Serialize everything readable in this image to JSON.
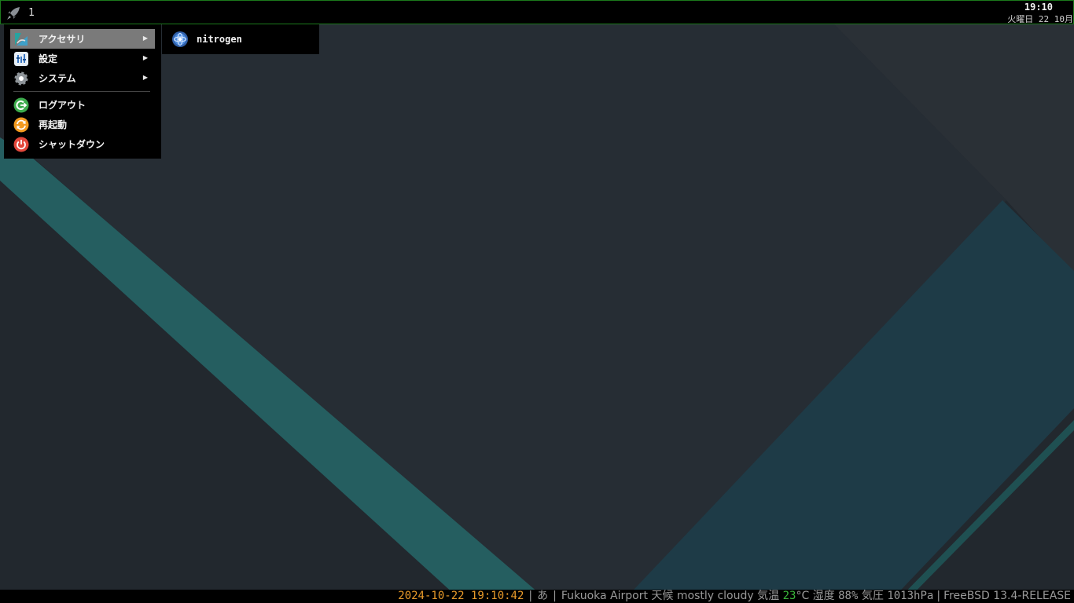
{
  "topbar": {
    "workspace": "1",
    "time": "19:10",
    "date": "火曜日 22 10月"
  },
  "menu": {
    "items": [
      {
        "label": "アクセサリ",
        "icon": "accessories-icon",
        "has_submenu": true,
        "active": true
      },
      {
        "label": "設定",
        "icon": "settings-icon",
        "has_submenu": true
      },
      {
        "label": "システム",
        "icon": "system-gear-icon",
        "has_submenu": true
      },
      {
        "label": "ログアウト",
        "icon": "logout-icon"
      },
      {
        "label": "再起動",
        "icon": "restart-icon"
      },
      {
        "label": "シャットダウン",
        "icon": "shutdown-icon"
      }
    ],
    "arrow": "▶"
  },
  "submenu": {
    "items": [
      {
        "label": "nitrogen",
        "icon": "nitrogen-icon"
      }
    ]
  },
  "statusbar": {
    "datetime": "2024-10-22 19:10:42",
    "ime": "あ",
    "location": "Fukuoka Airport",
    "weather_label": "天候",
    "weather": "mostly cloudy",
    "temp_label": "気温",
    "temp": "23",
    "temp_unit": "°C",
    "humidity_label": "湿度",
    "humidity": "88%",
    "pressure_label": "気圧",
    "pressure": "1013hPa",
    "os": "FreeBSD 13.4-RELEASE",
    "divider": "|"
  },
  "colors": {
    "desktop": "#252b31",
    "teal_stripe": "#1e5a5c",
    "teal_panel": "#1d3a46",
    "menu_active": "#7a7a7a",
    "topbar_border": "#1c7a1c",
    "status_orange": "#e89a2a",
    "status_green": "#39b53a"
  }
}
